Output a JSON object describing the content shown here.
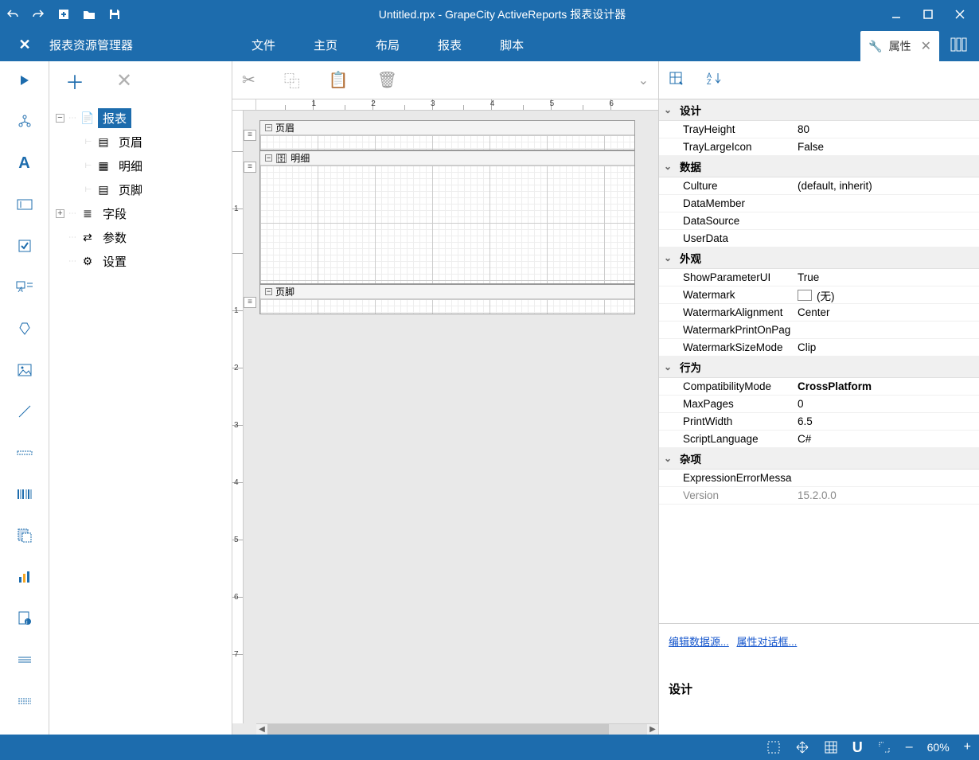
{
  "title": "Untitled.rpx - GrapeCity ActiveReports 报表设计器",
  "explorer_title": "报表资源管理器",
  "menu": {
    "file": "文件",
    "home": "主页",
    "layout": "布局",
    "report": "报表",
    "script": "脚本"
  },
  "properties_tab": "属性",
  "tree": {
    "report": "报表",
    "pageHeader": "页眉",
    "detail": "明细",
    "pageFooter": "页脚",
    "fields": "字段",
    "parameters": "参数",
    "settings": "设置"
  },
  "sections": {
    "pageHeader": "页眉",
    "detail": "明细",
    "pageFooter": "页脚"
  },
  "ruler": {
    "h": [
      "1",
      "2",
      "3",
      "4",
      "5",
      "6"
    ],
    "v": [
      "1",
      "2",
      "3",
      "4",
      "5",
      "6",
      "7"
    ]
  },
  "props": {
    "categories": {
      "design": "设计",
      "data": "数据",
      "appearance": "外观",
      "behavior": "行为",
      "misc": "杂项"
    },
    "items": {
      "TrayHeight": {
        "label": "TrayHeight",
        "value": "80"
      },
      "TrayLargeIcon": {
        "label": "TrayLargeIcon",
        "value": "False"
      },
      "Culture": {
        "label": "Culture",
        "value": "(default, inherit)"
      },
      "DataMember": {
        "label": "DataMember",
        "value": ""
      },
      "DataSource": {
        "label": "DataSource",
        "value": ""
      },
      "UserData": {
        "label": "UserData",
        "value": ""
      },
      "ShowParameterUI": {
        "label": "ShowParameterUI",
        "value": "True"
      },
      "Watermark": {
        "label": "Watermark",
        "value": "(无)"
      },
      "WatermarkAlignment": {
        "label": "WatermarkAlignment",
        "value": "Center"
      },
      "WatermarkPrintOnPag": {
        "label": "WatermarkPrintOnPag",
        "value": ""
      },
      "WatermarkSizeMode": {
        "label": "WatermarkSizeMode",
        "value": "Clip"
      },
      "CompatibilityMode": {
        "label": "CompatibilityMode",
        "value": "CrossPlatform"
      },
      "MaxPages": {
        "label": "MaxPages",
        "value": "0"
      },
      "PrintWidth": {
        "label": "PrintWidth",
        "value": "6.5"
      },
      "ScriptLanguage": {
        "label": "ScriptLanguage",
        "value": "C#"
      },
      "ExpressionErrorMessa": {
        "label": "ExpressionErrorMessa",
        "value": ""
      },
      "Version": {
        "label": "Version",
        "value": "15.2.0.0"
      }
    }
  },
  "links": {
    "editDataSource": "编辑数据源...",
    "propertyDialog": "属性对话框..."
  },
  "description_title": "设计",
  "statusbar": {
    "zoom": "60%",
    "minus": "–",
    "plus": "+"
  }
}
